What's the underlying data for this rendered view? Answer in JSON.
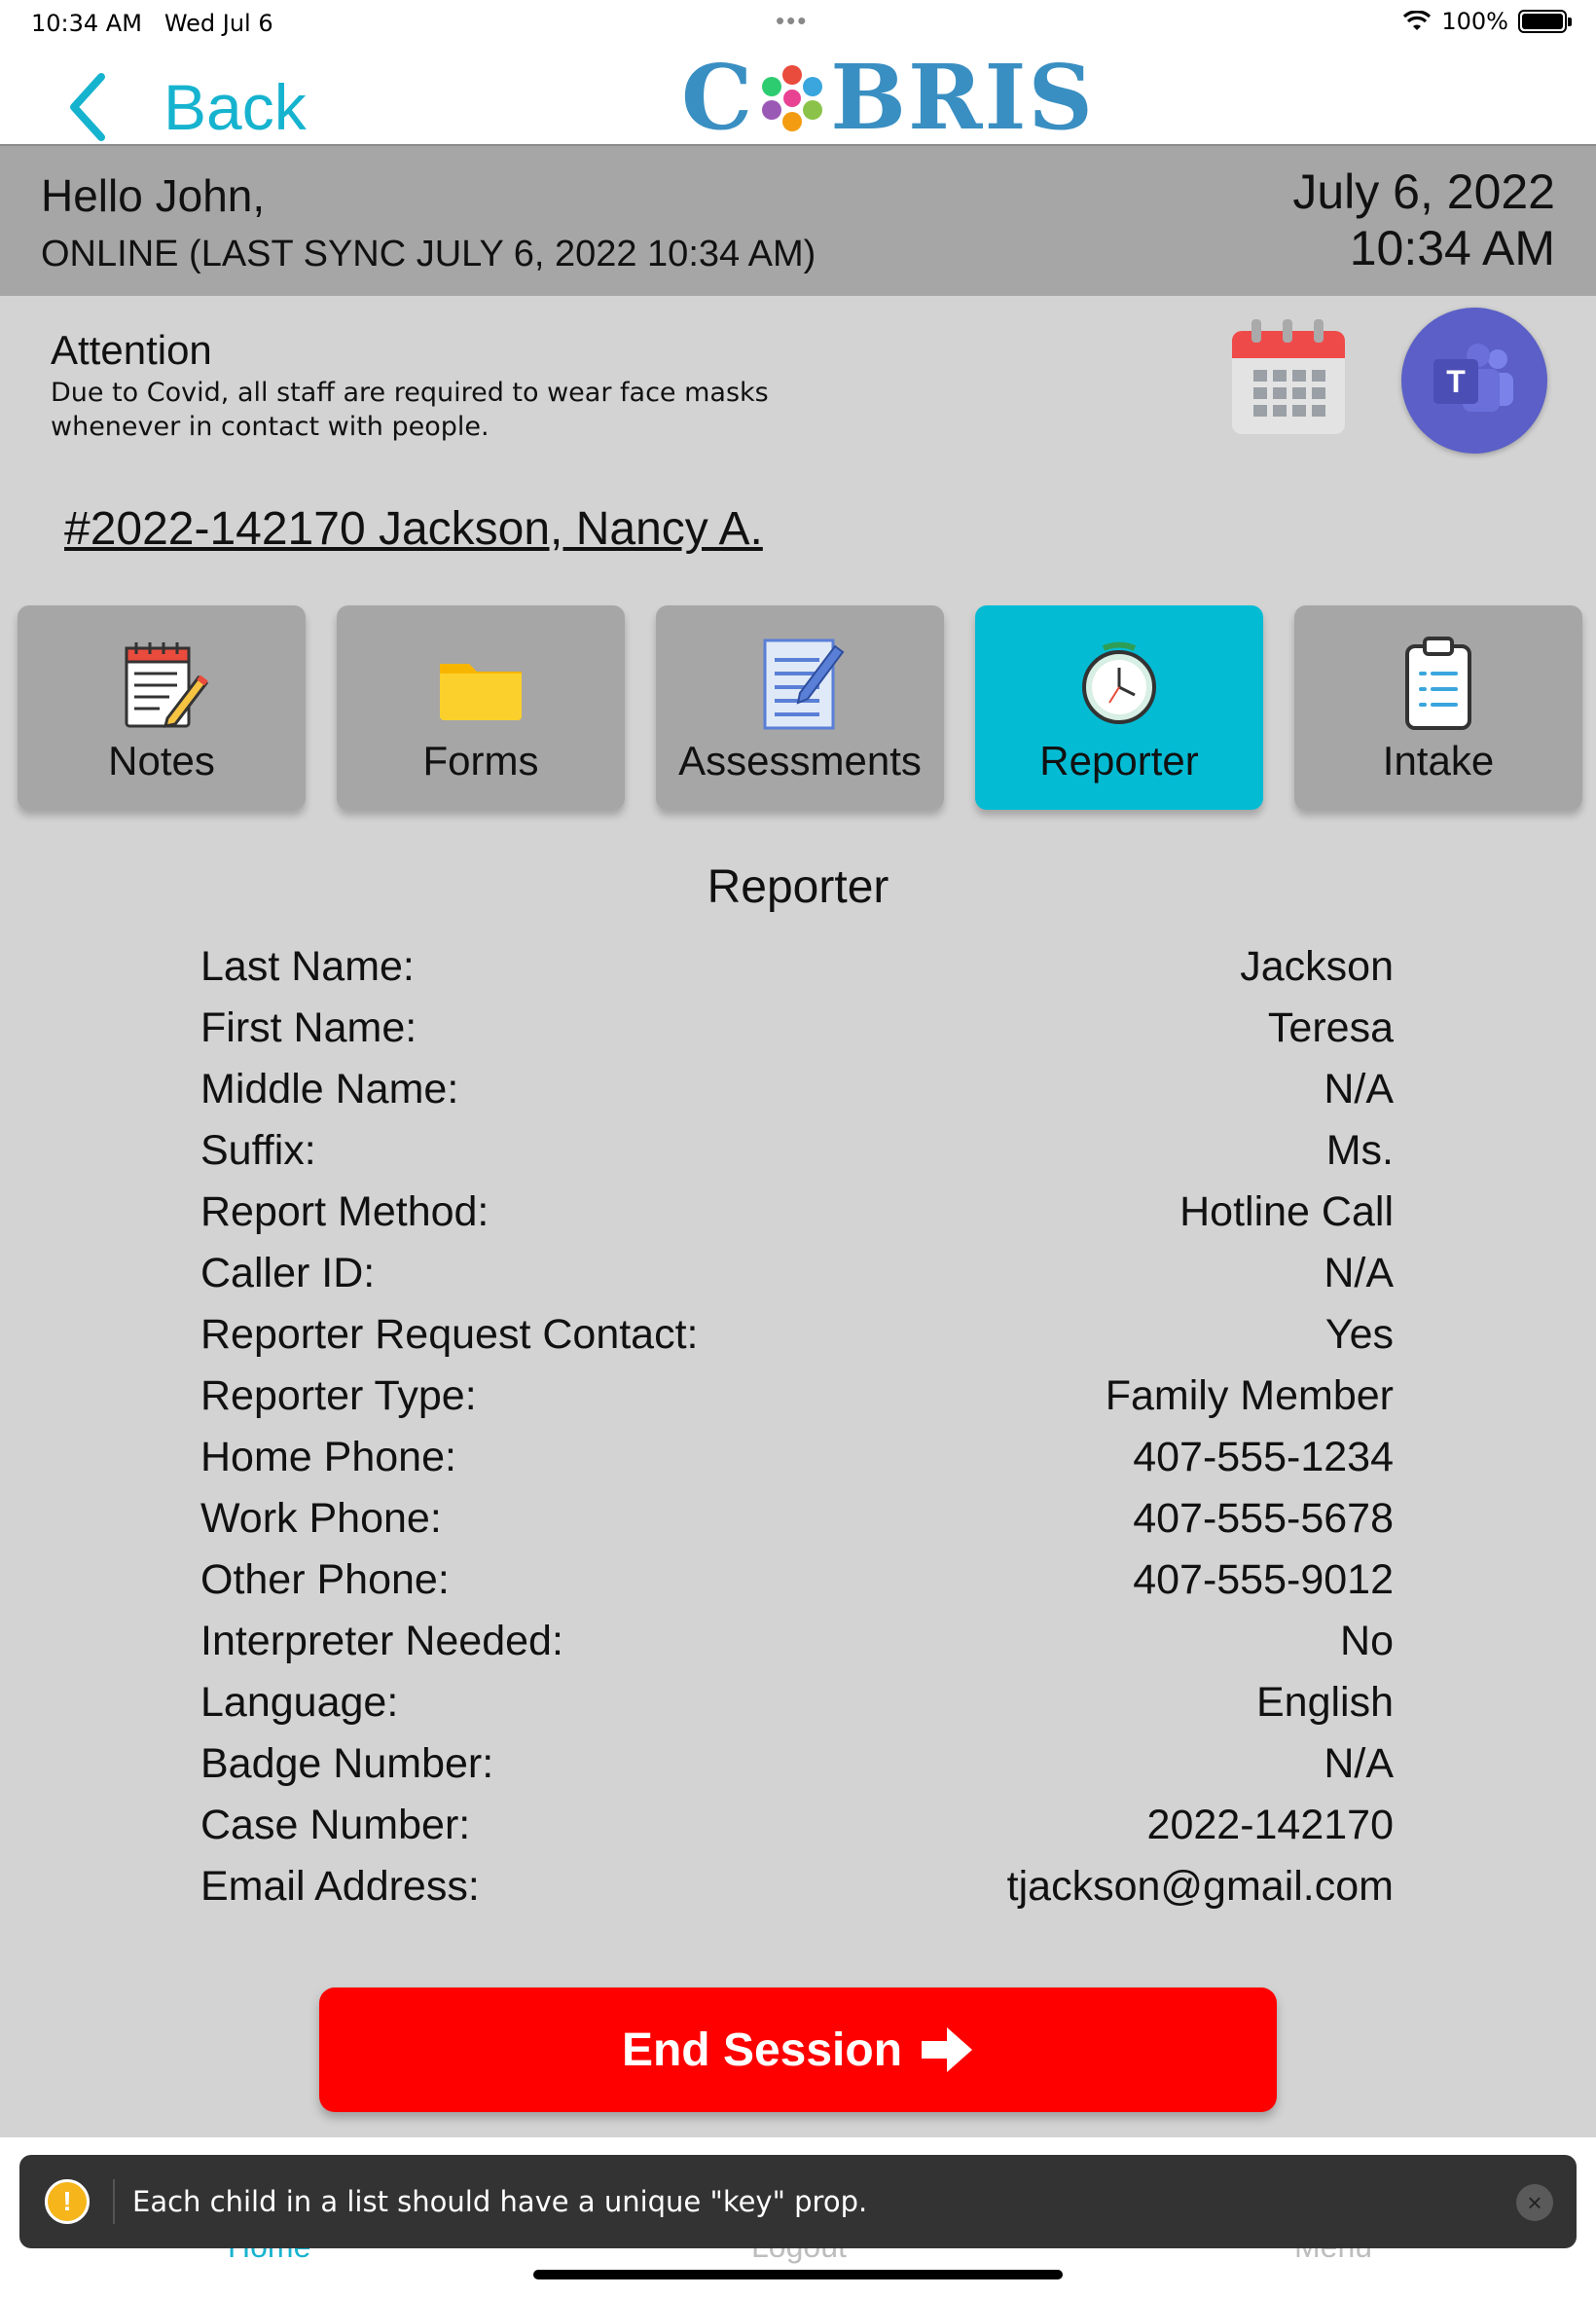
{
  "status": {
    "time": "10:34 AM",
    "date": "Wed Jul 6",
    "battery": "100%"
  },
  "nav": {
    "back_label": "Back",
    "logo_left": "C",
    "logo_right": "BRIS"
  },
  "header": {
    "greeting": "Hello John,",
    "sync_status": "ONLINE (LAST SYNC JULY 6, 2022 10:34 AM)",
    "date": "July 6, 2022",
    "time": "10:34 AM"
  },
  "attention": {
    "title": "Attention",
    "message": "Due to Covid, all staff are required to wear face masks whenever in contact with people."
  },
  "case": {
    "link": "#2022-142170 Jackson, Nancy A."
  },
  "tabs": [
    {
      "label": "Notes",
      "icon": "notes-icon"
    },
    {
      "label": "Forms",
      "icon": "folder-icon"
    },
    {
      "label": "Assessments",
      "icon": "assessment-icon"
    },
    {
      "label": "Reporter",
      "icon": "clock-icon",
      "active": true
    },
    {
      "label": "Intake",
      "icon": "clipboard-icon"
    }
  ],
  "section_title": "Reporter",
  "fields": [
    {
      "label": "Last Name:",
      "value": "Jackson"
    },
    {
      "label": "First Name:",
      "value": "Teresa"
    },
    {
      "label": "Middle Name:",
      "value": "N/A"
    },
    {
      "label": "Suffix:",
      "value": "Ms."
    },
    {
      "label": "Report Method:",
      "value": "Hotline Call"
    },
    {
      "label": "Caller ID:",
      "value": "N/A"
    },
    {
      "label": "Reporter Request Contact:",
      "value": "Yes"
    },
    {
      "label": "Reporter Type:",
      "value": "Family Member"
    },
    {
      "label": "Home Phone:",
      "value": "407-555-1234"
    },
    {
      "label": "Work Phone:",
      "value": "407-555-5678"
    },
    {
      "label": "Other Phone:",
      "value": "407-555-9012"
    },
    {
      "label": "Interpreter Needed:",
      "value": "No"
    },
    {
      "label": "Language:",
      "value": "English"
    },
    {
      "label": "Badge Number:",
      "value": "N/A"
    },
    {
      "label": "Case Number:",
      "value": "2022-142170"
    },
    {
      "label": "Email Address:",
      "value": "tjackson@gmail.com"
    }
  ],
  "end_session": {
    "label": "End Session"
  },
  "bottom_nav": {
    "home": "Home",
    "logout": "Logout",
    "menu": "Menu"
  },
  "toast": {
    "message": "Each child in a list should have a unique \"key\" prop."
  },
  "colors": {
    "accent": "#03bcd4",
    "danger": "#ff0000",
    "header_band": "#a6a6a6",
    "background": "#d3d3d3"
  }
}
